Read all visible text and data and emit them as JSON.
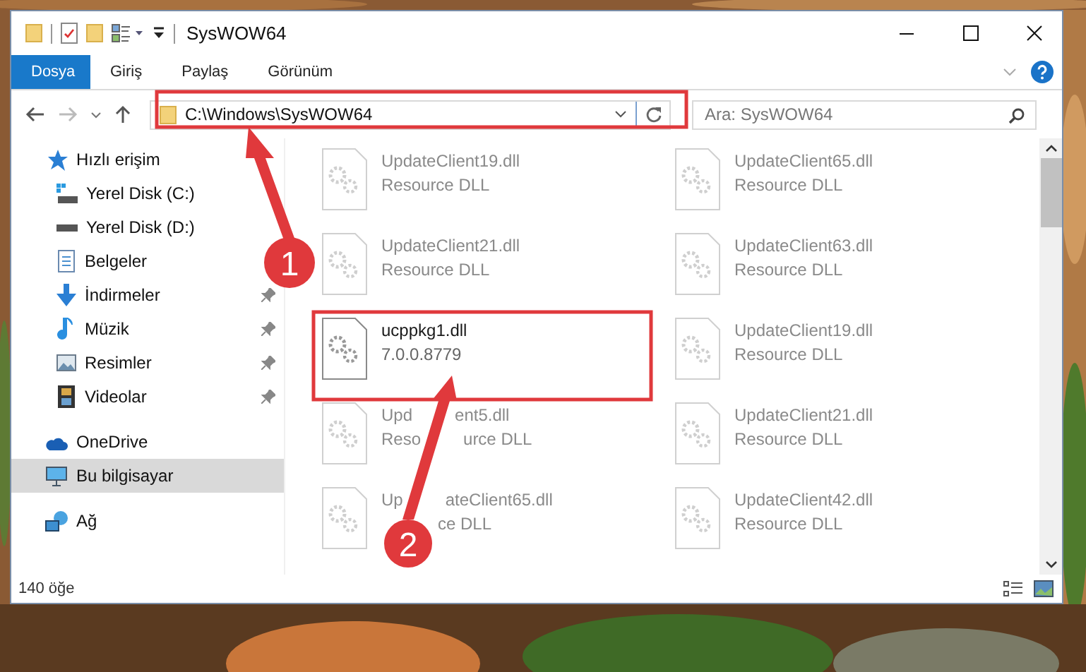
{
  "window": {
    "title": "SysWOW64"
  },
  "ribbon_tabs": [
    {
      "label": "Dosya",
      "selected": true
    },
    {
      "label": "Giriş",
      "selected": false
    },
    {
      "label": "Paylaş",
      "selected": false
    },
    {
      "label": "Görünüm",
      "selected": false
    }
  ],
  "address_bar": {
    "path": "C:\\Windows\\SysWOW64"
  },
  "search": {
    "placeholder": "Ara: SysWOW64"
  },
  "sidebar": {
    "items": [
      {
        "label": "Hızlı erişim",
        "selected": false,
        "children": [
          {
            "label": "Yerel Disk (C:)",
            "selected": false,
            "pinned": false
          },
          {
            "label": "Yerel Disk (D:)",
            "selected": false
          },
          {
            "label": "Belgeler",
            "selected": false
          },
          {
            "label": "İndirmeler",
            "selected": false,
            "pinned": true
          },
          {
            "label": "Müzik",
            "selected": false,
            "pinned": true
          },
          {
            "label": "Resimler",
            "selected": false,
            "pinned": true
          },
          {
            "label": "Videolar",
            "selected": false,
            "pinned": true
          }
        ]
      },
      {
        "label": "OneDrive",
        "selected": false
      },
      {
        "label": "Bu bilgisayar",
        "selected": true
      },
      {
        "label": "Ağ",
        "selected": false
      }
    ]
  },
  "files": [
    {
      "name_parts": [
        "UpdateClient19.dll"
      ],
      "detail_parts": [
        "Resource DLL"
      ],
      "blurred": true
    },
    {
      "name_parts": [
        "UpdateClient65.dll"
      ],
      "detail_parts": [
        "Resource DLL"
      ],
      "blurred": true
    },
    {
      "name_parts": [
        "UpdateClient21.dll"
      ],
      "detail_parts": [
        "Resource DLL"
      ],
      "blurred": true
    },
    {
      "name_parts": [
        "UpdateClient63.dll"
      ],
      "detail_parts": [
        "Resource DLL"
      ],
      "blurred": true
    },
    {
      "name_parts": [
        "ucppkg1.dll"
      ],
      "detail_parts": [
        "7.0.0.8779"
      ],
      "blurred": false
    },
    {
      "name_parts": [
        "UpdateClient19.dll"
      ],
      "detail_parts": [
        "Resource DLL"
      ],
      "blurred": true
    },
    {
      "name_parts": [
        "Upd",
        "ent5.dll"
      ],
      "detail_parts": [
        "Reso",
        "urce DLL"
      ],
      "blurred": true
    },
    {
      "name_parts": [
        "UpdateClient21.dll"
      ],
      "detail_parts": [
        "Resource DLL"
      ],
      "blurred": true
    },
    {
      "name_parts": [
        "Up",
        "ateClient65.dll"
      ],
      "detail_parts": [
        "ce DLL"
      ],
      "detail_indent": true,
      "blurred": true
    },
    {
      "name_parts": [
        "UpdateClient42.dll"
      ],
      "detail_parts": [
        "Resource DLL"
      ],
      "blurred": true
    }
  ],
  "status_bar": {
    "item_count": "140 öğe"
  },
  "callouts": [
    {
      "number": "1"
    },
    {
      "number": "2"
    }
  ]
}
